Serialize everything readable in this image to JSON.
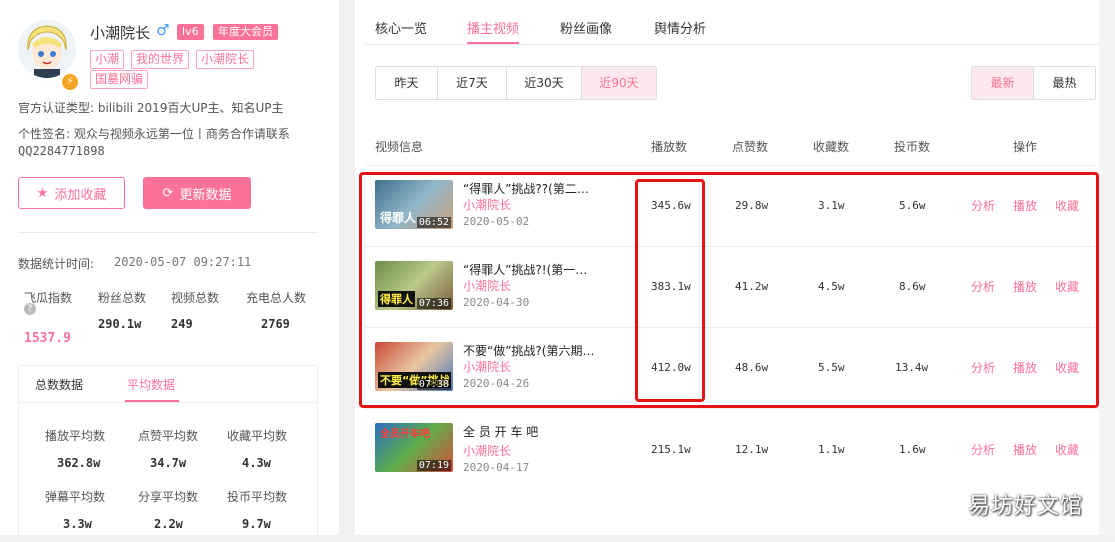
{
  "profile": {
    "name": "小潮院长",
    "gender_icon": "male-icon",
    "level": "lv6",
    "vip": "年度大会员",
    "tags": [
      "小潮",
      "我的世界",
      "小潮院长",
      "国墓网骗"
    ],
    "certification": "官方认证类型: bilibili 2019百大UP主、知名UP主",
    "signature": "个性签名: 观众与视频永远第一位丨商务合作请联系",
    "qq": "QQ2284771898",
    "add_fav": "添加收藏",
    "update": "更新数据"
  },
  "stats": {
    "time_label": "数据统计时间:",
    "time_value": "2020-05-07 09:27:11",
    "items": [
      {
        "label": "飞瓜指数",
        "value": "1537.9"
      },
      {
        "label": "粉丝总数",
        "value": "290.1w"
      },
      {
        "label": "视频总数",
        "value": "249"
      },
      {
        "label": "充电总人数",
        "value": "2769"
      }
    ]
  },
  "avg": {
    "tabs": [
      "总数数据",
      "平均数据"
    ],
    "active_tab": 1,
    "items": [
      {
        "label": "播放平均数",
        "value": "362.8w"
      },
      {
        "label": "点赞平均数",
        "value": "34.7w"
      },
      {
        "label": "收藏平均数",
        "value": "4.3w"
      },
      {
        "label": "弹幕平均数",
        "value": "3.3w"
      },
      {
        "label": "分享平均数",
        "value": "2.2w"
      },
      {
        "label": "投币平均数",
        "value": "9.7w"
      }
    ]
  },
  "nav_tabs": [
    "核心一览",
    "播主视频",
    "粉丝画像",
    "舆情分析"
  ],
  "active_nav": 1,
  "ranges": [
    "昨天",
    "近7天",
    "近30天",
    "近90天"
  ],
  "active_range": 3,
  "sorts": [
    "最新",
    "最热"
  ],
  "active_sort": 0,
  "table": {
    "headers": [
      "视频信息",
      "播放数",
      "点赞数",
      "收藏数",
      "投币数",
      "操作"
    ],
    "actions": [
      "分析",
      "播放",
      "收藏"
    ],
    "rows": [
      {
        "title": "“得罪人”挑战??(第二…",
        "author": "小潮院长",
        "date": "2020-05-02",
        "duration": "06:52",
        "caption": "得罪人",
        "plays": "345.6w",
        "likes": "29.8w",
        "favs": "3.1w",
        "coins": "5.6w"
      },
      {
        "title": "“得罪人”挑战?!(第一…",
        "author": "小潮院长",
        "date": "2020-04-30",
        "duration": "07:36",
        "caption": "得罪人",
        "plays": "383.1w",
        "likes": "41.2w",
        "favs": "4.5w",
        "coins": "8.6w"
      },
      {
        "title": "不要“做”挑战?(第六期…",
        "author": "小潮院长",
        "date": "2020-04-26",
        "duration": "07:38",
        "caption": "不要“做”挑战",
        "plays": "412.0w",
        "likes": "48.6w",
        "favs": "5.5w",
        "coins": "13.4w"
      },
      {
        "title": "全 员 开 车 吧",
        "author": "小潮院长",
        "date": "2020-04-17",
        "duration": "07:19",
        "caption": "全员开车吧",
        "plays": "215.1w",
        "likes": "12.1w",
        "favs": "1.1w",
        "coins": "1.6w"
      }
    ]
  },
  "watermark": "易坊好文馆",
  "colors": {
    "accent": "#fb7299",
    "highlight": "#e51414"
  }
}
